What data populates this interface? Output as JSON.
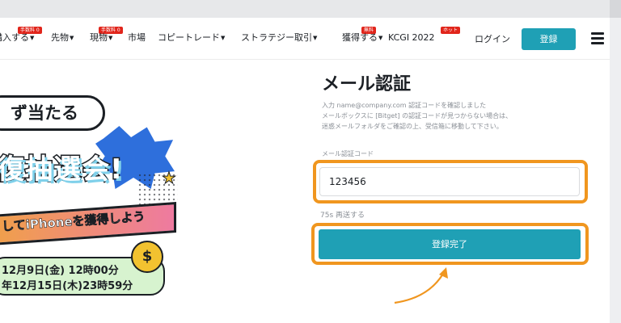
{
  "nav": {
    "items": [
      {
        "label": "購入する",
        "badge": "手数料 0"
      },
      {
        "label": "先物"
      },
      {
        "label": "現物",
        "badge": "手数料 0"
      },
      {
        "label": "市場"
      },
      {
        "label": "コピートレード"
      },
      {
        "label": "ストラテジー取引"
      },
      {
        "label": "獲得する",
        "badge": "無料"
      },
      {
        "label": "KCGI 2022",
        "badge": "ホット"
      }
    ],
    "login_label": "ログイン",
    "register_label": "登録"
  },
  "promo": {
    "line1": "ず当たる",
    "line2": "復抽選会!",
    "banner": "してiPhoneを獲得しよう",
    "date_start": "12月9日(金) 12時00分",
    "date_end": "年12月15日(木)23時59分"
  },
  "form": {
    "title": "メール認証",
    "desc_line1": "入力 name@company.com 認証コードを確認しました",
    "desc_line2": "メールボックスに [Bitget] の認証コードが見つからない場合は、",
    "desc_line3": "迷惑メールフォルダをご確認の上、受信箱に移動して下さい。",
    "code_label": "メール認証コード",
    "code_value": "123456",
    "resend_text": "75s 再送する",
    "submit_label": "登録完了"
  },
  "colors": {
    "accent": "#1fa0b5",
    "highlight": "#f0961f",
    "badge": "#e1251b"
  }
}
